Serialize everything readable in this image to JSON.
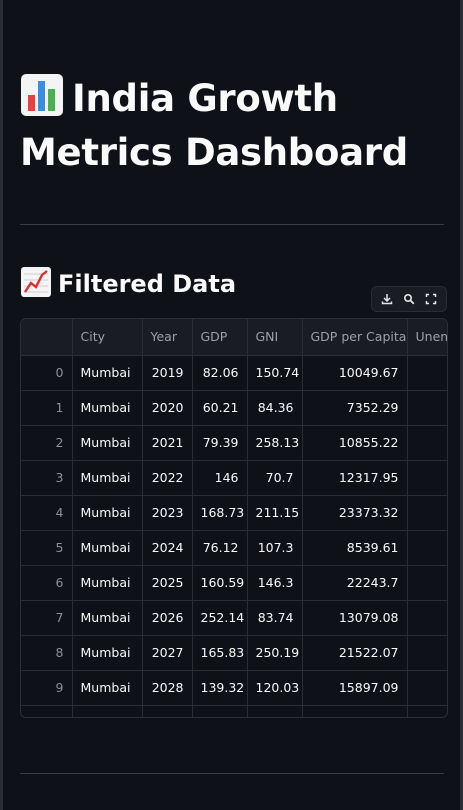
{
  "header": {
    "title": "India Growth Metrics Dashboard",
    "title_icon": "bar-chart-emoji"
  },
  "section": {
    "title": "Filtered Data",
    "title_icon": "chart-increasing-emoji"
  },
  "toolbar": {
    "icons": [
      "download-icon",
      "search-icon",
      "fullscreen-icon"
    ]
  },
  "table": {
    "columns": [
      "",
      "City",
      "Year",
      "GDP",
      "GNI",
      "GDP per Capita",
      "Unem"
    ],
    "rows": [
      {
        "index": "0",
        "city": "Mumbai",
        "year": "2019",
        "gdp": "82.06",
        "gni": "150.74",
        "gdp_per_capita": "10049.67"
      },
      {
        "index": "1",
        "city": "Mumbai",
        "year": "2020",
        "gdp": "60.21",
        "gni": "84.36",
        "gdp_per_capita": "7352.29"
      },
      {
        "index": "2",
        "city": "Mumbai",
        "year": "2021",
        "gdp": "79.39",
        "gni": "258.13",
        "gdp_per_capita": "10855.22"
      },
      {
        "index": "3",
        "city": "Mumbai",
        "year": "2022",
        "gdp": "146",
        "gni": "70.7",
        "gdp_per_capita": "12317.95"
      },
      {
        "index": "4",
        "city": "Mumbai",
        "year": "2023",
        "gdp": "168.73",
        "gni": "211.15",
        "gdp_per_capita": "23373.32"
      },
      {
        "index": "5",
        "city": "Mumbai",
        "year": "2024",
        "gdp": "76.12",
        "gni": "107.3",
        "gdp_per_capita": "8539.61"
      },
      {
        "index": "6",
        "city": "Mumbai",
        "year": "2025",
        "gdp": "160.59",
        "gni": "146.3",
        "gdp_per_capita": "22243.7"
      },
      {
        "index": "7",
        "city": "Mumbai",
        "year": "2026",
        "gdp": "252.14",
        "gni": "83.74",
        "gdp_per_capita": "13079.08"
      },
      {
        "index": "8",
        "city": "Mumbai",
        "year": "2027",
        "gdp": "165.83",
        "gni": "250.19",
        "gdp_per_capita": "21522.07"
      },
      {
        "index": "9",
        "city": "Mumbai",
        "year": "2028",
        "gdp": "139.32",
        "gni": "120.03",
        "gdp_per_capita": "15897.09"
      }
    ]
  }
}
